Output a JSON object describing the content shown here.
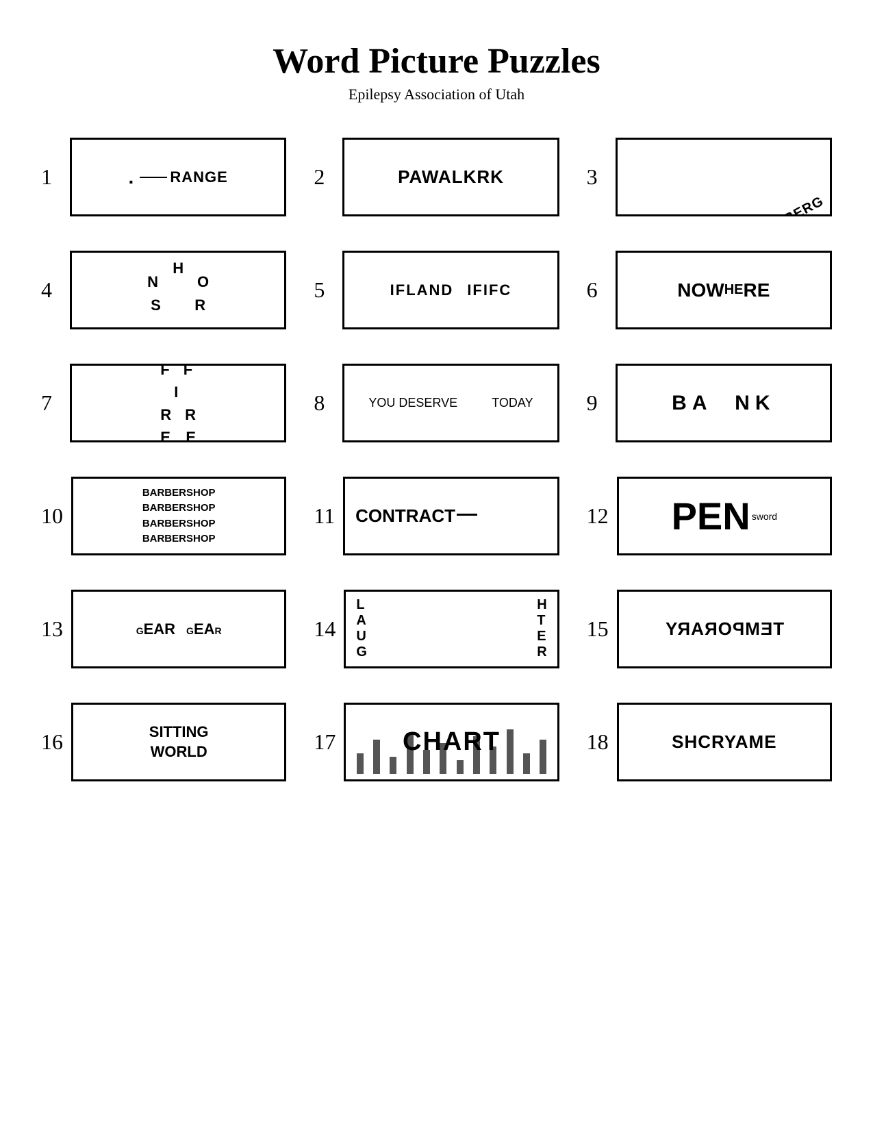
{
  "title": "Word Picture Puzzles",
  "subtitle": "Epilepsy Association of Utah",
  "puzzles": [
    {
      "number": "1",
      "description": "dot blank RANGE",
      "parts": [
        ". ___ RANGE"
      ]
    },
    {
      "number": "2",
      "description": "PAWALKRK",
      "text": "PAWALKRK"
    },
    {
      "number": "3",
      "description": "ICEBERG rotated",
      "text": "ICEBERG"
    },
    {
      "number": "4",
      "description": "HORNS in circle",
      "text": "HORNS"
    },
    {
      "number": "5",
      "description": "IFLAND IFIFC",
      "text1": "IFLAND",
      "text2": "IFIFC"
    },
    {
      "number": "6",
      "description": "NOWHERE with HE superscript",
      "now": "NOW",
      "he": "HE",
      "re": "RE"
    },
    {
      "number": "7",
      "description": "F F I R R E E",
      "letters": [
        "F",
        "F",
        "I",
        "",
        "R",
        "R",
        "E",
        "",
        "E"
      ]
    },
    {
      "number": "8",
      "description": "YOU DESERVE TODAY",
      "text1": "YOU DESERVE",
      "text2": "TODAY"
    },
    {
      "number": "9",
      "description": "BA NK with space",
      "text": "BA  NK"
    },
    {
      "number": "10",
      "description": "BARBERSHOP x4",
      "lines": [
        "BARBERSHOP",
        "BARBERSHOP",
        "BARBERSHOP",
        "BARBERSHOP"
      ]
    },
    {
      "number": "11",
      "description": "CONTRACT with line",
      "text": "CONTRACT"
    },
    {
      "number": "12",
      "description": "PEN sword",
      "big": "PEN",
      "small": "sword"
    },
    {
      "number": "13",
      "description": "GEAR GEAR with sub/superscript",
      "gear1": {
        "sub": "G",
        "main": "EAR",
        "sup": ""
      },
      "gear2": {
        "sub": "G",
        "main": "EAR",
        "sup": "R"
      }
    },
    {
      "number": "14",
      "description": "LAUGH HTER",
      "left": [
        "L",
        "A",
        "U",
        "G"
      ],
      "right": [
        "H",
        "T",
        "E",
        "R"
      ]
    },
    {
      "number": "15",
      "description": "TEMPORARY reversed",
      "text": "TEMPORARY"
    },
    {
      "number": "16",
      "description": "SITTING WORLD",
      "line1": "SITTING",
      "line2": "WORLD"
    },
    {
      "number": "17",
      "description": "CHART with bar chart background",
      "text": "CHART"
    },
    {
      "number": "18",
      "description": "SHCRYAME",
      "text": "SHCRYAME"
    }
  ]
}
